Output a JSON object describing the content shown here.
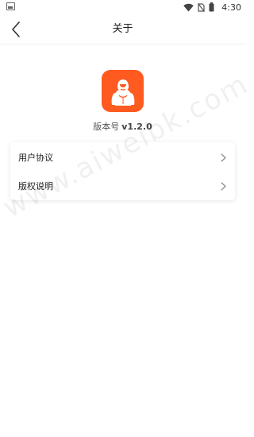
{
  "status_bar": {
    "time": "4:30",
    "icons": [
      "image-icon",
      "wifi-icon",
      "no-sim-icon",
      "battery-icon"
    ]
  },
  "nav": {
    "title": "关于",
    "back_icon": "chevron-left-icon"
  },
  "app": {
    "icon": "gorilla-logo",
    "brand_color": "#ff5a1f",
    "version_label": "版本号",
    "version_number": "v1.2.0"
  },
  "menu": {
    "items": [
      {
        "label": "用户协议",
        "icon": "chevron-right-icon"
      },
      {
        "label": "版权说明",
        "icon": "chevron-right-icon"
      }
    ]
  },
  "watermark": {
    "text": "www.aiweibk.com"
  }
}
